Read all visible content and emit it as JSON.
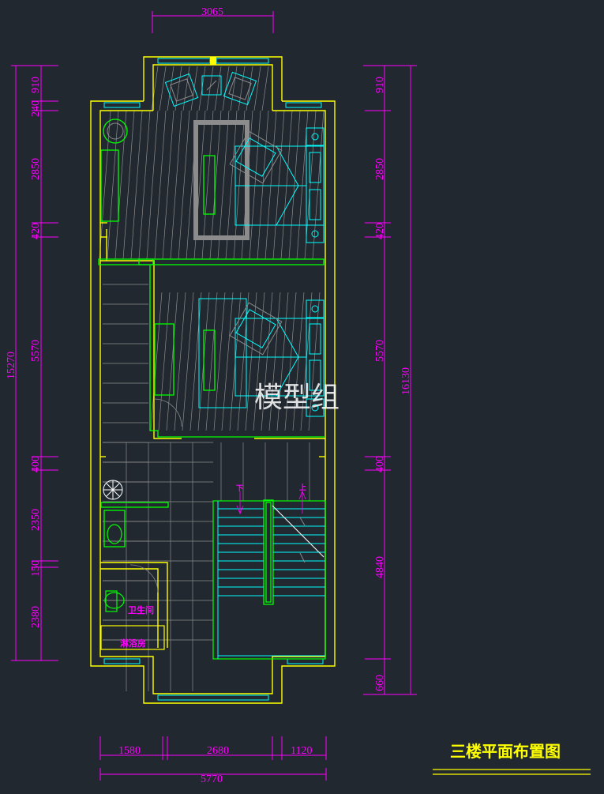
{
  "drawing": {
    "title": "三楼平面布置图",
    "watermark": "模型组"
  },
  "dimensions": {
    "top": "3065",
    "left_total": "15270",
    "right_total": "16130",
    "left": [
      "910",
      "240",
      "2850",
      "420",
      "5570",
      "400",
      "2350",
      "150",
      "2380"
    ],
    "right": [
      "910",
      "2850",
      "420",
      "5570",
      "400",
      "4840",
      "660"
    ],
    "bottom": [
      "1580",
      "2680",
      "1120"
    ],
    "bottom_total": "5770"
  },
  "labels": {
    "toilet": "卫生间",
    "shower": "淋浴房",
    "stair_down": "下",
    "stair_up": "上"
  },
  "colors": {
    "background": "#212830",
    "wall": "#ffff00",
    "dimension": "#ff00ff",
    "furniture": "#00ffff",
    "green": "#00ff00",
    "grey": "#8c8c8c",
    "red": "#ff3030"
  }
}
